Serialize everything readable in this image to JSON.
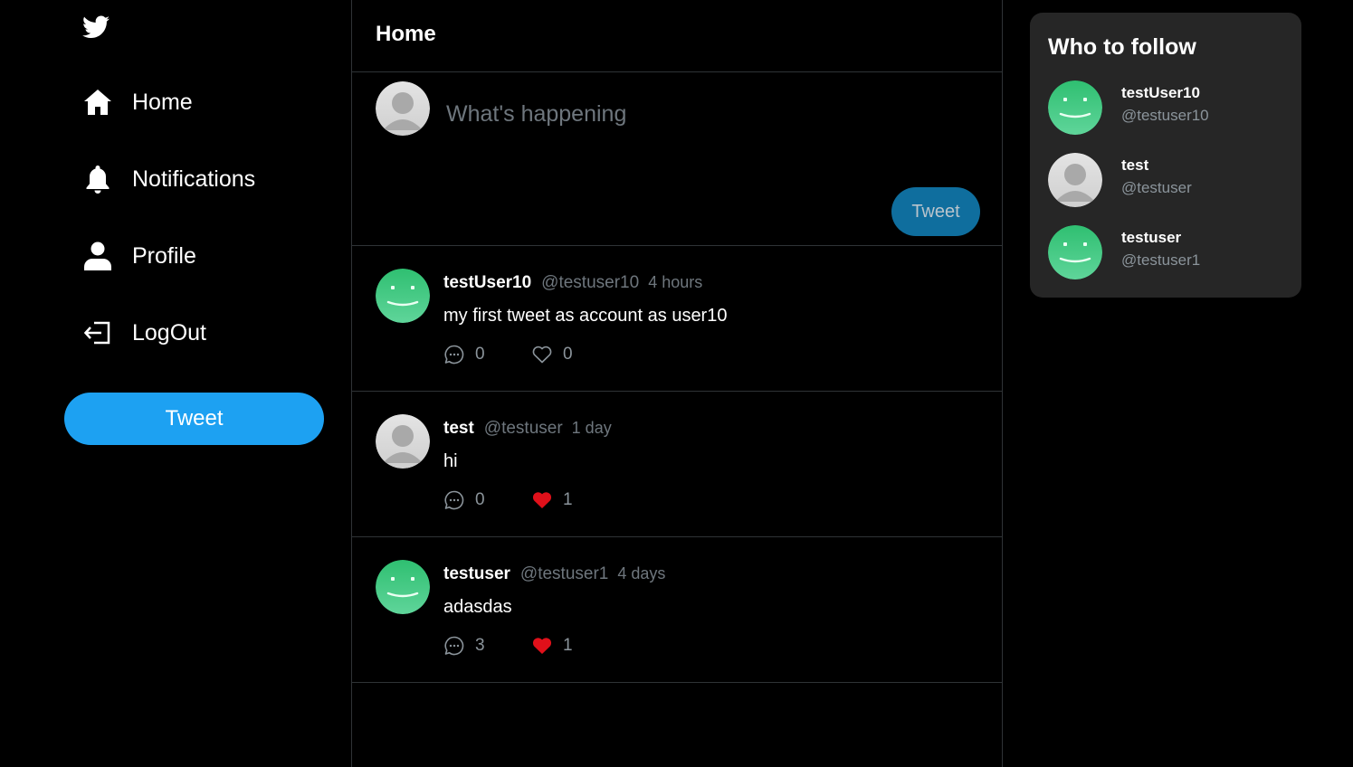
{
  "brand": {
    "logo_icon": "twitter-bird-icon"
  },
  "sidebar": {
    "items": [
      {
        "label": "Home",
        "icon": "home-icon"
      },
      {
        "label": "Notifications",
        "icon": "bell-icon"
      },
      {
        "label": "Profile",
        "icon": "user-icon"
      },
      {
        "label": "LogOut",
        "icon": "logout-icon"
      }
    ],
    "tweet_button": "Tweet"
  },
  "main": {
    "title": "Home",
    "composer": {
      "placeholder": "What's happening",
      "tweet_button": "Tweet"
    },
    "tweets": [
      {
        "name": "testUser10",
        "handle": "@testuser10",
        "time": "4 hours",
        "text": "my first tweet as account as user10",
        "replies": "0",
        "likes": "0",
        "liked": false,
        "avatar": "smiley-avatar"
      },
      {
        "name": "test",
        "handle": "@testuser",
        "time": "1 day",
        "text": "hi",
        "replies": "0",
        "likes": "1",
        "liked": true,
        "avatar": "default-avatar"
      },
      {
        "name": "testuser",
        "handle": "@testuser1",
        "time": "4 days",
        "text": "adasdas",
        "replies": "3",
        "likes": "1",
        "liked": true,
        "avatar": "smiley-avatar"
      }
    ]
  },
  "who_to_follow": {
    "title": "Who to follow",
    "users": [
      {
        "name": "testUser10",
        "handle": "@testuser10",
        "avatar": "smiley-avatar"
      },
      {
        "name": "test",
        "handle": "@testuser",
        "avatar": "default-avatar"
      },
      {
        "name": "testuser",
        "handle": "@testuser1",
        "avatar": "smiley-avatar"
      }
    ]
  },
  "colors": {
    "background": "#000000",
    "accent": "#1da1f2",
    "composer_button": "#0f6e9e",
    "like_active": "#e0101a",
    "muted_text": "#6e767d",
    "panel": "#262626",
    "divider": "#2f3336"
  }
}
